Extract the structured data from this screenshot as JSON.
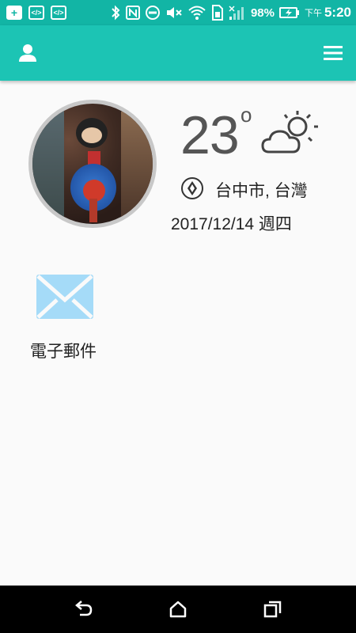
{
  "status_bar": {
    "battery_percent": "98%",
    "time_prefix": "下午",
    "time": "5:20",
    "icons": [
      "add-box-icon",
      "code-icon",
      "code-icon",
      "bluetooth-icon",
      "nfc-icon",
      "do-not-disturb-icon",
      "volume-mute-icon",
      "wifi-icon",
      "sim-icon",
      "signal-icon",
      "battery-charging-icon"
    ]
  },
  "toolbar": {
    "left_icon": "user-icon",
    "right_icon": "menu-icon",
    "color": "#1cc4b4"
  },
  "weather": {
    "temperature": "23",
    "degree_symbol": "o",
    "condition_icon": "partly-cloudy-icon",
    "location": "台中市, 台灣",
    "date": "2017/12/14 週四"
  },
  "apps": {
    "email": {
      "label": "電子郵件",
      "icon": "email-icon",
      "color": "#a5dbf8"
    }
  },
  "nav_bar": {
    "buttons": [
      "back-icon",
      "home-icon",
      "recents-icon"
    ]
  }
}
